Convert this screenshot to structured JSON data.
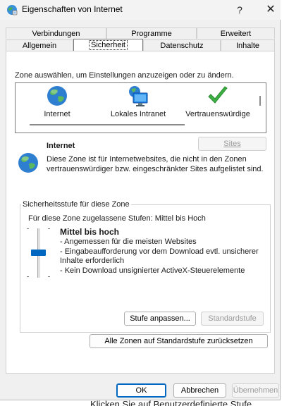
{
  "window": {
    "title": "Eigenschaften von Internet",
    "help": "?",
    "close": "✕"
  },
  "tabs_row1": [
    "Verbindungen",
    "Programme",
    "Erweitert"
  ],
  "tabs_row2": [
    "Allgemein",
    "Sicherheit",
    "Datenschutz",
    "Inhalte"
  ],
  "active_tab": "Sicherheit",
  "zones": {
    "label": "Zone auswählen, um Einstellungen anzuzeigen oder zu ändern.",
    "items": [
      {
        "label": "Internet",
        "icon": "globe-icon"
      },
      {
        "label": "Lokales Intranet",
        "icon": "intranet-monitor-icon"
      },
      {
        "label": "Vertrauenswürdige",
        "icon": "green-check-icon"
      }
    ]
  },
  "selected_zone": {
    "title": "Internet",
    "description": "Diese Zone ist für Internetwebsites, die nicht in den Zonen vertrauenswürdiger bzw. eingeschränkter Sites aufgelistet sind.",
    "sites_button": "Sites"
  },
  "security_level": {
    "group_title": "Sicherheitsstufe für diese Zone",
    "allowed": "Für diese Zone zugelassene Stufen: Mittel bis Hoch",
    "level_name": "Mittel bis hoch",
    "bullets": [
      "- Angemessen für die meisten Websites",
      "- Eingabeaufforderung vor dem Download evtl. unsicherer",
      "Inhalte erforderlich",
      "- Kein Download unsignierter ActiveX-Steuerelemente"
    ],
    "custom_button": "Stufe anpassen...",
    "default_button": "Standardstufe"
  },
  "reset_all_button": "Alle Zonen auf Standardstufe zurücksetzen",
  "footer": {
    "ok": "OK",
    "cancel": "Abbrechen",
    "apply": "Übernehmen"
  },
  "background_text": "Klicken Sie auf Benutzerdefinierte Stufe"
}
